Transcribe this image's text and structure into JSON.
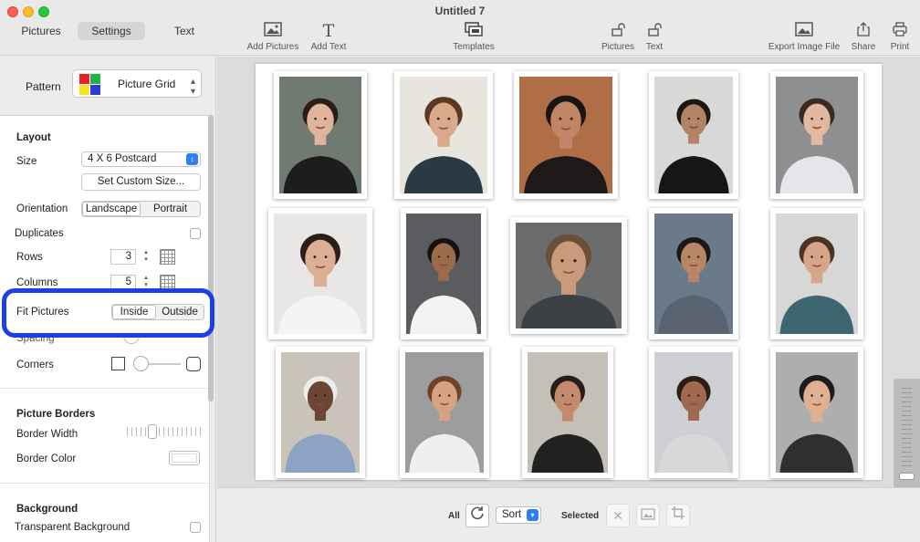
{
  "window": {
    "title": "Untitled 7"
  },
  "tabs": [
    {
      "label": "Pictures"
    },
    {
      "label": "Settings"
    },
    {
      "label": "Text"
    }
  ],
  "toolbar": {
    "add_pictures": "Add Pictures",
    "add_text": "Add Text",
    "templates": "Templates",
    "pictures": "Pictures",
    "text": "Text",
    "export": "Export Image File",
    "share": "Share",
    "print": "Print"
  },
  "sidebar": {
    "pattern_label": "Pattern",
    "pattern_value": "Picture Grid",
    "layout": {
      "heading": "Layout",
      "size_label": "Size",
      "size_value": "4 X 6 Postcard",
      "custom_size": "Set Custom Size...",
      "orientation_label": "Orientation",
      "orientation_options": [
        "Landscape",
        "Portrait"
      ],
      "orientation_selected": "Landscape",
      "duplicates_label": "Duplicates",
      "duplicates_checked": false,
      "rows_label": "Rows",
      "rows_value": "3",
      "columns_label": "Columns",
      "columns_value": "5",
      "fit_label": "Fit Pictures",
      "fit_options": [
        "Inside",
        "Outside"
      ],
      "fit_selected": "Inside",
      "spacing_label": "Spacing",
      "corners_label": "Corners"
    },
    "borders": {
      "heading": "Picture Borders",
      "width_label": "Border Width",
      "color_label": "Border Color"
    },
    "background": {
      "heading": "Background",
      "transparent_label": "Transparent Background",
      "transparent_checked": false
    }
  },
  "photos": [
    {
      "bg": "#6f7b72",
      "skin": "#e0b49a",
      "hair": "#2a1c16",
      "shirt": "#1d1d1d"
    },
    {
      "bg": "#e8e4de",
      "skin": "#d9a98c",
      "hair": "#5a3a24",
      "shirt": "#2a3a44"
    },
    {
      "bg": "#b06e47",
      "skin": "#c08466",
      "hair": "#1a1412",
      "shirt": "#1e1a1a"
    },
    {
      "bg": "#d8d8d6",
      "skin": "#b48266",
      "hair": "#1e1714",
      "shirt": "#161616"
    },
    {
      "bg": "#8d8f90",
      "skin": "#e1b9a0",
      "hair": "#3a2a22",
      "shirt": "#e6e6ea"
    },
    {
      "bg": "#e8e7e5",
      "skin": "#dcae94",
      "hair": "#2a1e18",
      "shirt": "#f4f4f4"
    },
    {
      "bg": "#5b5c60",
      "skin": "#9d6a4c",
      "hair": "#161212",
      "shirt": "#f3f3f3"
    },
    {
      "bg": "#6b6c6c",
      "skin": "#c99a7c",
      "hair": "#6b5038",
      "shirt": "#3c4146"
    },
    {
      "bg": "#6a7a8a",
      "skin": "#b88566",
      "hair": "#1c1815",
      "shirt": "#5a6470"
    },
    {
      "bg": "#d7d7d8",
      "skin": "#d6a488",
      "hair": "#4a3424",
      "shirt": "#3e6670"
    },
    {
      "bg": "#c9c3b9",
      "skin": "#6b4634",
      "hair": "#ececec",
      "shirt": "#8da3c4"
    },
    {
      "bg": "#9b9d9f",
      "skin": "#d7a282",
      "hair": "#6e4426",
      "shirt": "#efefef"
    },
    {
      "bg": "#c4c0b8",
      "skin": "#c48a6c",
      "hair": "#2a1c18",
      "shirt": "#222222"
    },
    {
      "bg": "#cdcfd2",
      "skin": "#a06a4e",
      "hair": "#2a1e18",
      "shirt": "#d8d8d8"
    },
    {
      "bg": "#adaeb0",
      "skin": "#e0b090",
      "hair": "#1c1c1c",
      "shirt": "#2f2f2f"
    }
  ],
  "bottom": {
    "all_label": "All",
    "sort_label": "Sort",
    "selected_label": "Selected"
  }
}
